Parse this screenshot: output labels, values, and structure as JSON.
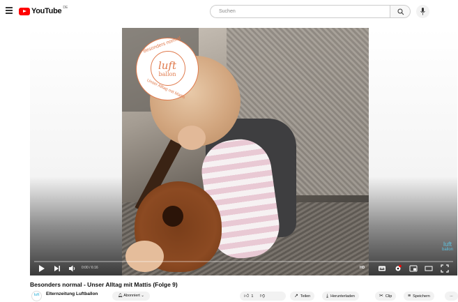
{
  "header": {
    "logo_text": "YouTube",
    "logo_region": "DE",
    "search_placeholder": "Suchen"
  },
  "player": {
    "badge_top": "Besonders normal",
    "badge_logo_big": "luft",
    "badge_logo_small": "ballon",
    "badge_bottom": "Unser Alltag mit Mattis",
    "watermark_big": "luft",
    "watermark_small": "ballon",
    "time": "0:00 / 6:16",
    "progress_fraction": 0.0,
    "quality_badge": "HD"
  },
  "video": {
    "title": "Besonders normal - Unser Alltag mit Mattis (Folge 9)",
    "channel_name": "Elternzeitung Luftballon",
    "channel_avatar": "luft",
    "subscribe_label": "Abonniert",
    "like_count": "1",
    "share_label": "Teilen",
    "download_label": "Herunterladen",
    "clip_label": "Clip",
    "save_label": "Speichern",
    "more_label": "..."
  },
  "colors": {
    "brand_red": "#ff0000",
    "badge_orange": "#e07a4c",
    "watermark_blue": "#5ec2e0"
  }
}
